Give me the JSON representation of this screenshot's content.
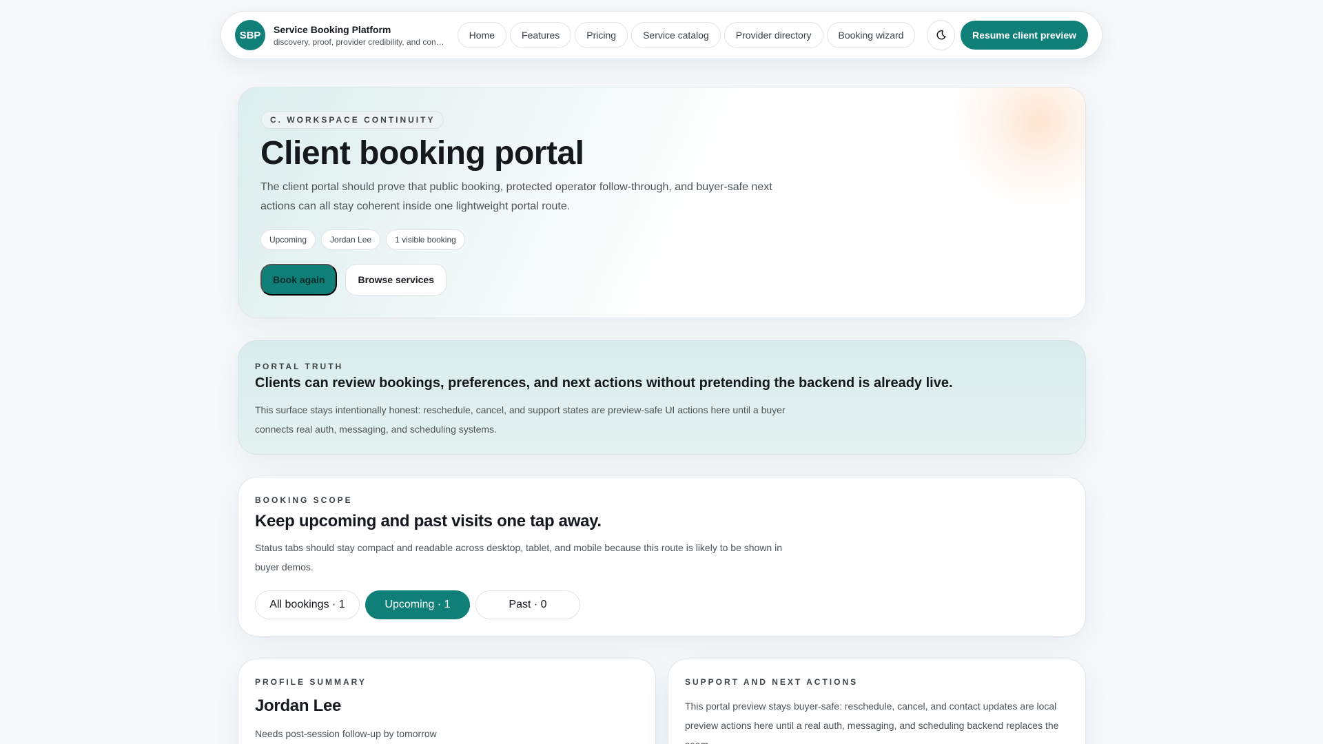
{
  "header": {
    "badge": "SBP",
    "title": "Service Booking Platform",
    "subtitle": "discovery, proof, provider credibility, and con…",
    "nav": [
      "Home",
      "Features",
      "Pricing",
      "Service catalog",
      "Provider directory",
      "Booking wizard"
    ],
    "theme_icon": "moon-icon",
    "cta": "Resume client preview"
  },
  "hero": {
    "eyebrow": "C. WORKSPACE CONTINUITY",
    "title": "Client booking portal",
    "description": "The client portal should prove that public booking, protected operator follow-through, and buyer-safe next actions can all stay coherent inside one lightweight portal route.",
    "tags": [
      "Upcoming",
      "Jordan Lee",
      "1 visible booking"
    ],
    "primary_action": "Book again",
    "secondary_action": "Browse services"
  },
  "truth": {
    "label": "PORTAL TRUTH",
    "heading": "Clients can review bookings, preferences, and next actions without pretending the backend is already live.",
    "body": "This surface stays intentionally honest: reschedule, cancel, and support states are preview-safe UI actions here until a buyer connects real auth, messaging, and scheduling systems."
  },
  "scope": {
    "label": "BOOKING SCOPE",
    "heading": "Keep upcoming and past visits one tap away.",
    "body": "Status tabs should stay compact and readable across desktop, tablet, and mobile because this route is likely to be shown in buyer demos.",
    "tabs": [
      "All bookings · 1",
      "Upcoming · 1",
      "Past · 0"
    ],
    "active_tab": "Upcoming · 1"
  },
  "profile": {
    "label": "PROFILE SUMMARY",
    "name": "Jordan Lee",
    "note": "Needs post-session follow-up by tomorrow"
  },
  "support": {
    "label": "SUPPORT AND NEXT ACTIONS",
    "body": "This portal preview stays buyer-safe: reschedule, cancel, and contact updates are local preview actions here until a real auth, messaging, and scheduling backend replaces the seam."
  },
  "colors": {
    "accent": "#0f7f78",
    "page_bg": "#f6f8fa",
    "truth_bg": "#dfeeee"
  }
}
